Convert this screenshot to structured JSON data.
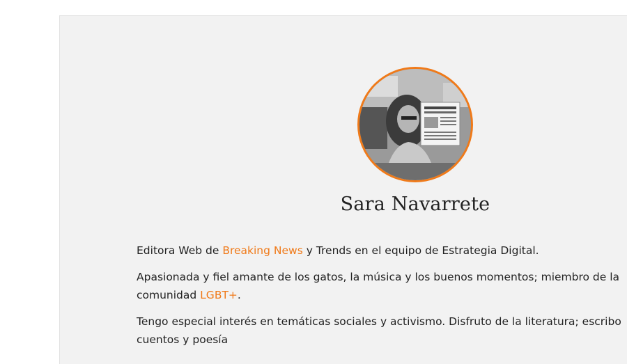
{
  "profile": {
    "name": "Sara Navarrete",
    "accent_color": "#f07a19",
    "avatar_icon": "author-photo"
  },
  "bio": {
    "p1": {
      "before": "Editora Web de ",
      "link": "Breaking News",
      "after": " y Trends en el equipo de Estrategia Digital."
    },
    "p2": {
      "line1": "Apasionada y fiel amante de los gatos, la música y los buenos momentos; miembro de la",
      "before": "comunidad ",
      "link": "LGBT+",
      "after": "."
    },
    "p3": {
      "line1": "Tengo especial interés en temáticas sociales y activismo. Disfruto de la literatura; escribo",
      "line2": "cuentos y poesía"
    }
  }
}
